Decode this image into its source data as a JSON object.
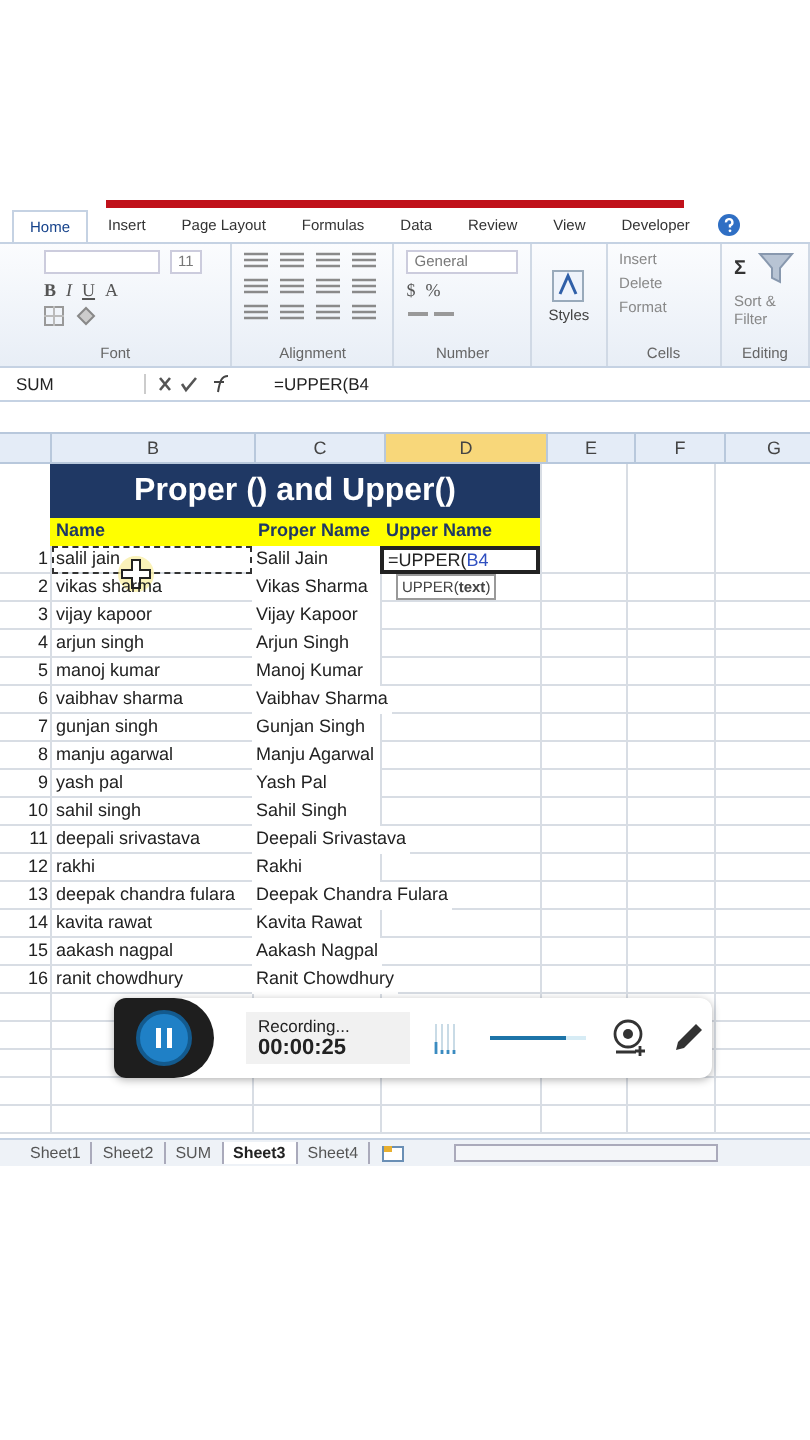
{
  "ribbon": {
    "tabs": [
      {
        "label": "Home",
        "selected": true
      },
      {
        "label": "Insert",
        "selected": false
      },
      {
        "label": "Page Layout",
        "selected": false
      },
      {
        "label": "Formulas",
        "selected": false
      },
      {
        "label": "Data",
        "selected": false
      },
      {
        "label": "Review",
        "selected": false
      },
      {
        "label": "View",
        "selected": false
      },
      {
        "label": "Developer",
        "selected": false
      }
    ],
    "font_size": "11",
    "font_buttons": [
      "B",
      "I",
      "U",
      "A"
    ],
    "number_format": "General",
    "number_buttons": [
      "$",
      "%"
    ],
    "styles": "Styles",
    "cells_buttons": [
      "Insert",
      "Delete",
      "Format"
    ],
    "sum_symbol": "Σ",
    "sort_label": "Sort &",
    "filter_label": "Filter",
    "groups": [
      "Font",
      "Alignment",
      "Number",
      "Cells",
      "Editing"
    ]
  },
  "formula_bar": {
    "name_box": "SUM",
    "formula": "=UPPER(B4"
  },
  "columns": [
    {
      "label": "B",
      "selected": false
    },
    {
      "label": "C",
      "selected": false
    },
    {
      "label": "D",
      "selected": true
    },
    {
      "label": "E",
      "selected": false
    },
    {
      "label": "F",
      "selected": false
    },
    {
      "label": "G",
      "selected": false
    }
  ],
  "title": "Proper () and Upper()",
  "headers": [
    "Name",
    "Proper Name",
    "Upper Name"
  ],
  "editing_cell": {
    "text": "=UPPER(",
    "reference": "B4",
    "tooltip": "UPPER(**text**)"
  },
  "rows": [
    {
      "number": "1",
      "name": "salil jain",
      "proper": "Salil Jain"
    },
    {
      "number": "2",
      "name": "vikas sharma",
      "proper": "Vikas Sharma"
    },
    {
      "number": "3",
      "name": "vijay kapoor",
      "proper": "Vijay Kapoor"
    },
    {
      "number": "4",
      "name": "arjun singh",
      "proper": "Arjun Singh"
    },
    {
      "number": "5",
      "name": "manoj kumar",
      "proper": "Manoj Kumar"
    },
    {
      "number": "6",
      "name": "vaibhav sharma",
      "proper": "Vaibhav Sharma"
    },
    {
      "number": "7",
      "name": "gunjan singh",
      "proper": "Gunjan Singh"
    },
    {
      "number": "8",
      "name": "manju agarwal",
      "proper": "Manju Agarwal"
    },
    {
      "number": "9",
      "name": "yash pal",
      "proper": "Yash Pal"
    },
    {
      "number": "10",
      "name": "sahil singh",
      "proper": "Sahil Singh"
    },
    {
      "number": "11",
      "name": "deepali srivastava",
      "proper": "Deepali Srivastava"
    },
    {
      "number": "12",
      "name": "rakhi",
      "proper": "Rakhi"
    },
    {
      "number": "13",
      "name": "deepak chandra fulara",
      "proper": "Deepak Chandra Fulara"
    },
    {
      "number": "14",
      "name": "kavita rawat",
      "proper": "Kavita Rawat"
    },
    {
      "number": "15",
      "name": "aakash nagpal",
      "proper": "Aakash Nagpal"
    },
    {
      "number": "16",
      "name": "ranit chowdhury",
      "proper": "Ranit Chowdhury"
    }
  ],
  "recorder": {
    "status": "Recording...",
    "time": "00:00:25",
    "volume": {
      "level": 0.8
    }
  },
  "sheet_tabs": [
    {
      "label": "Sheet1",
      "selected": false
    },
    {
      "label": "Sheet2",
      "selected": false
    },
    {
      "label": "SUM",
      "selected": false
    },
    {
      "label": "Sheet3",
      "selected": true
    },
    {
      "label": "Sheet4",
      "selected": false
    }
  ]
}
